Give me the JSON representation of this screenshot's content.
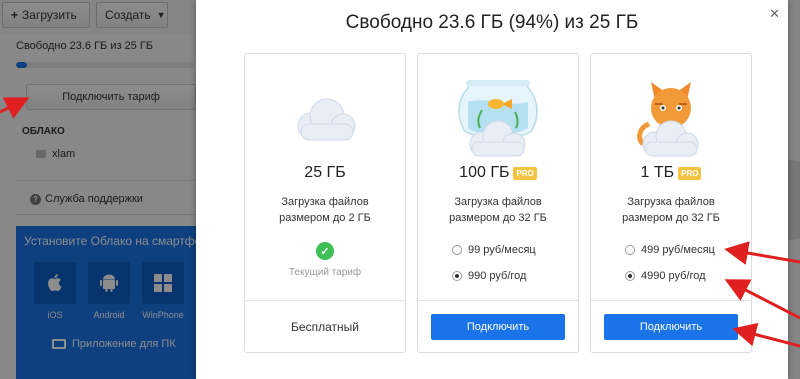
{
  "toolbar": {
    "upload_label": "Загрузить",
    "create_label": "Создать"
  },
  "sidebar": {
    "storage_text": "Свободно 23.6 ГБ из 25 ГБ",
    "storage_used_fraction": 0.06,
    "tariff_button": "Подключить тариф",
    "cloud_heading": "ОБЛАКО",
    "folder_name": "xlam",
    "support_label": "Служба поддержки",
    "promo": {
      "title": "Установите Облако на смартфон",
      "os": [
        {
          "label": "iOS",
          "icon": "apple-icon"
        },
        {
          "label": "Android",
          "icon": "android-icon"
        },
        {
          "label": "WinPhone",
          "icon": "windows-icon"
        }
      ],
      "pc_label": "Приложение для ПК"
    }
  },
  "modal": {
    "title": "Свободно 23.6 ГБ (94%) из 25 ГБ",
    "close_symbol": "✕",
    "plans": [
      {
        "size": "25 ГБ",
        "pro": false,
        "desc_line1": "Загрузка файлов",
        "desc_line2": "размером до 2 ГБ",
        "current_label": "Текущий тариф",
        "footer_label": "Бесплатный",
        "art": "cloud"
      },
      {
        "size": "100 ГБ",
        "pro": true,
        "pro_label": "PRO",
        "desc_line1": "Загрузка файлов",
        "desc_line2": "размером до 32 ГБ",
        "price_month": "99 руб/месяц",
        "price_year": "990 руб/год",
        "selected": "year",
        "button_label": "Подключить",
        "art": "fishbowl"
      },
      {
        "size": "1 ТБ",
        "pro": true,
        "pro_label": "PRO",
        "desc_line1": "Загрузка файлов",
        "desc_line2": "размером до 32 ГБ",
        "price_month": "499 руб/месяц",
        "price_year": "4990 руб/год",
        "selected": "year",
        "button_label": "Подключить",
        "art": "cat"
      }
    ]
  },
  "colors": {
    "accent": "#1a73e8",
    "pro_badge": "#f5c242",
    "success": "#3fbf58",
    "annotation_arrow": "#e02020"
  }
}
